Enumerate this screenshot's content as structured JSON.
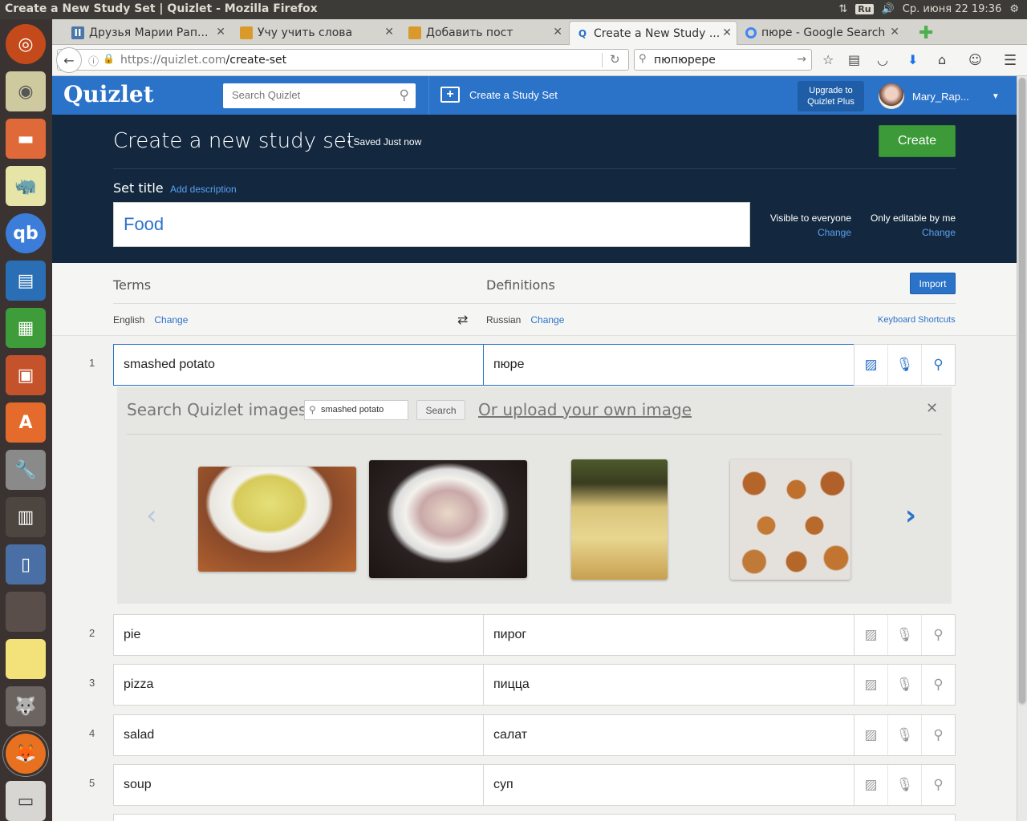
{
  "window_title": "Create a New Study Set | Quizlet - Mozilla Firefox",
  "system_tray": {
    "keyboard": "Ru",
    "datetime": "Ср. июня 22 19:36"
  },
  "browser": {
    "tabs": [
      {
        "label": "Друзья Марии Рап...",
        "icon": "vk-icon",
        "active": false
      },
      {
        "label": "Учу учить слова",
        "icon": "folder-icon",
        "active": false
      },
      {
        "label": "Добавить пост",
        "icon": "folder-icon",
        "active": false
      },
      {
        "label": "Create a New Study ...",
        "icon": "quizlet-icon",
        "active": true
      },
      {
        "label": "пюре - Google Search",
        "icon": "google-icon",
        "active": false
      }
    ],
    "url_host": "https://quizlet.com",
    "url_path": "/create-set",
    "search_value": "пюпюрере"
  },
  "quizlet": {
    "logo": "Quizlet",
    "search_placeholder": "Search Quizlet",
    "create_link": "Create a Study Set",
    "upgrade_line1": "Upgrade to",
    "upgrade_line2": "Quizlet Plus",
    "username": "Mary_Rap..."
  },
  "editor": {
    "page_title": "Create a new study set",
    "saved_status": "Saved Just now",
    "create_button": "Create",
    "set_title_label": "Set title",
    "add_description": "Add description",
    "title_value": "Food",
    "visibility_label": "Visible to everyone",
    "visibility_change": "Change",
    "editable_label": "Only editable by me",
    "editable_change": "Change",
    "terms_header": "Terms",
    "definitions_header": "Definitions",
    "import_button": "Import",
    "term_language": "English",
    "term_language_change": "Change",
    "definition_language": "Russian",
    "definition_language_change": "Change",
    "keyboard_shortcuts": "Keyboard Shortcuts"
  },
  "cards": [
    {
      "num": "1",
      "term": "smashed potato",
      "definition": "пюре"
    },
    {
      "num": "2",
      "term": "pie",
      "definition": "пирог"
    },
    {
      "num": "3",
      "term": "pizza",
      "definition": "пицца"
    },
    {
      "num": "4",
      "term": "salad",
      "definition": "салат"
    },
    {
      "num": "5",
      "term": "soup",
      "definition": "суп"
    }
  ],
  "image_panel": {
    "heading": "Search Quizlet images",
    "search_value": "smashed potato",
    "search_button": "Search",
    "upload_link": "Or upload your own image"
  },
  "colors": {
    "brand_blue": "#2b72c9",
    "dark_navy": "#13283f",
    "create_green": "#3c9b38"
  }
}
